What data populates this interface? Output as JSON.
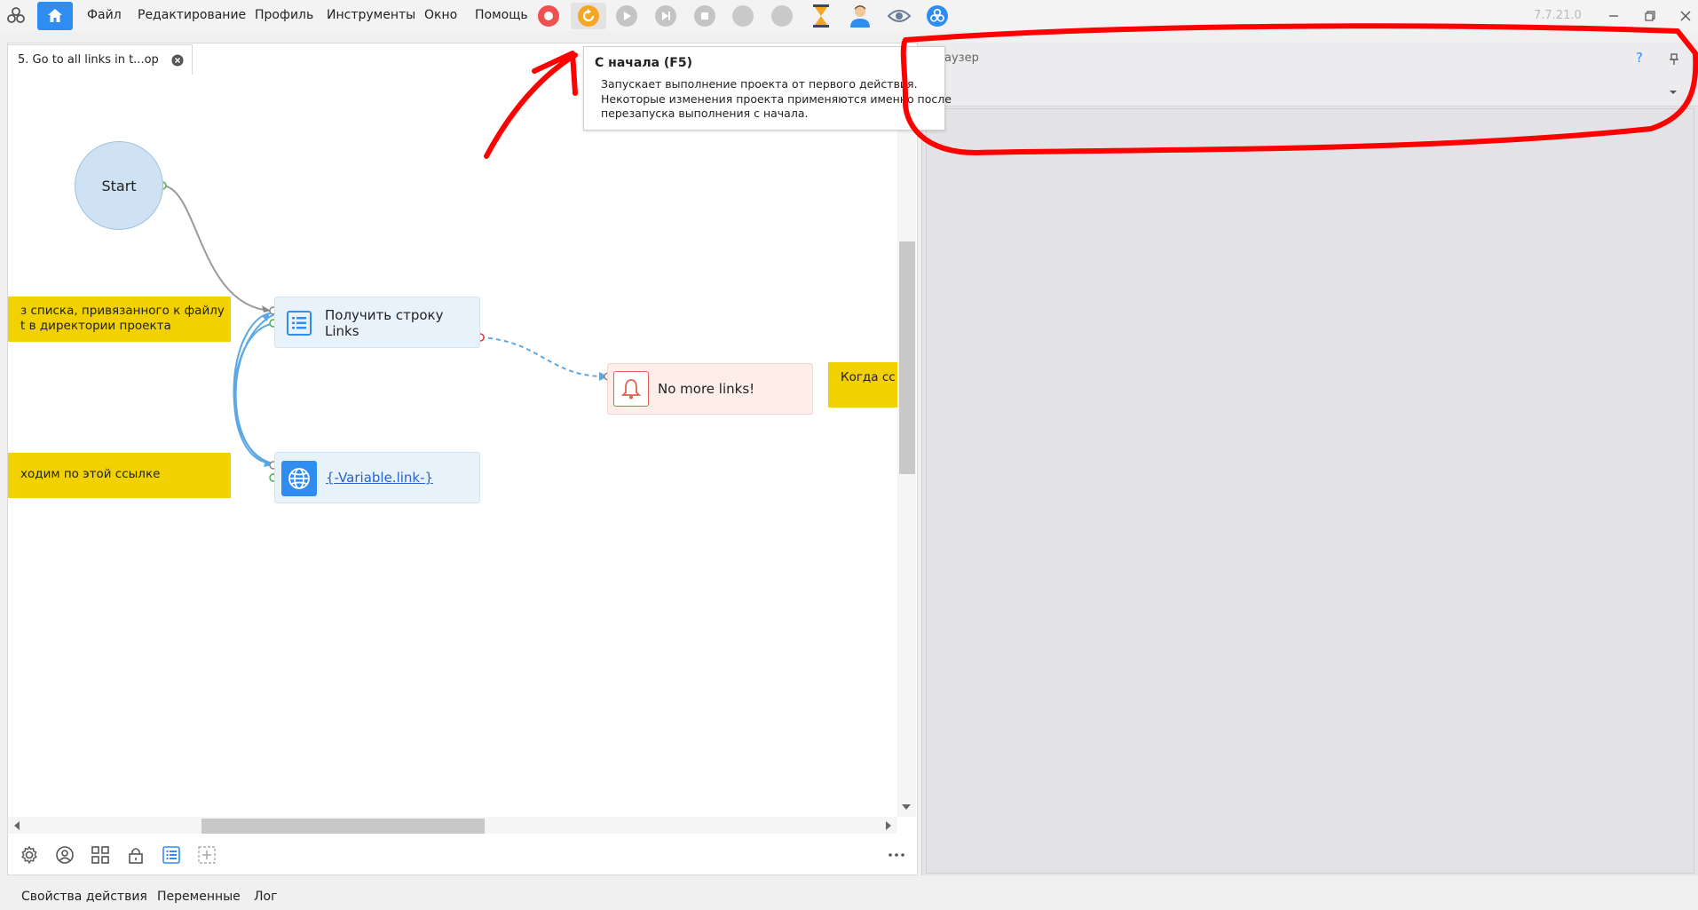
{
  "app": {
    "version": "7.7.21.0",
    "accent_color": "#2f8df2",
    "menu": [
      "Файл",
      "Редактирование",
      "Профиль",
      "Инструменты",
      "Окно",
      "Помощь"
    ]
  },
  "toolbar": {
    "icons": [
      "record-icon",
      "restart-icon",
      "play-icon",
      "step-icon",
      "stop-icon",
      "circle-icon",
      "circle-icon",
      "hourglass-icon",
      "user-icon",
      "eye-icon",
      "zennoposter-logo-icon"
    ]
  },
  "tooltip": {
    "title": "С начала (F5)",
    "body": "Запускает выполнение проекта от первого действия.\nНекоторые изменения проекта применяются именно после\nперезапуска выполнения с начала."
  },
  "editor": {
    "tab_label": "5. Go to all links in t...op",
    "nodes": {
      "start_label": "Start",
      "get_line_label_1": "Получить строку",
      "get_line_label_2": "Links",
      "no_more_links_label": "No more links!",
      "navigate_label": "{-Variable.link-}"
    },
    "notes": {
      "note1_line1": "з списка, привязанного к файлу",
      "note1_line2": "t в директории проекта",
      "note2": "ходим по этой ссылке",
      "note3": "Когда сс"
    }
  },
  "browser": {
    "title": "аузер",
    "help": "?"
  },
  "bottom_tabs": [
    "Свойства действия",
    "Переменные",
    "Лог"
  ],
  "annotation_color": "#ff0000"
}
